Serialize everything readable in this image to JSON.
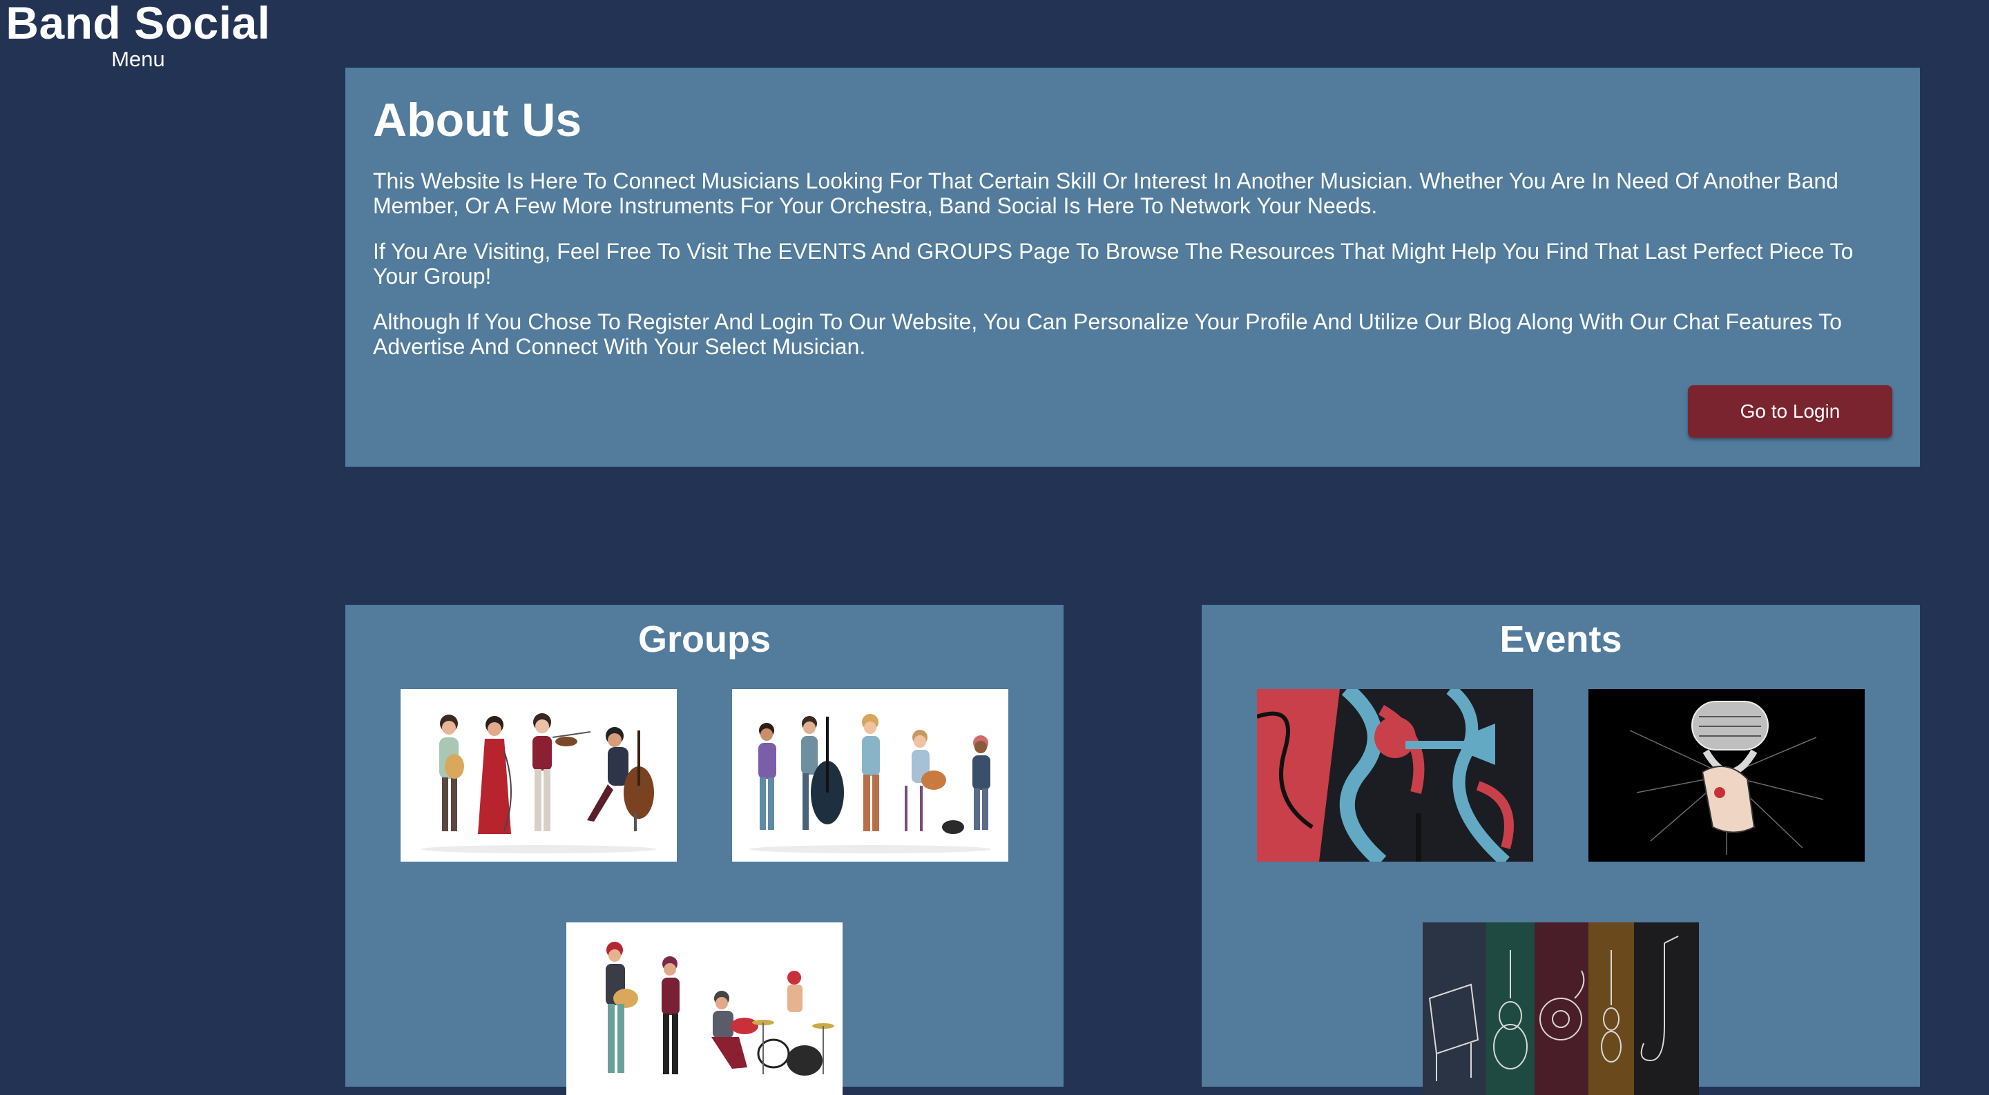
{
  "sidebar": {
    "brand": "Band Social",
    "menu_label": "Menu"
  },
  "about": {
    "title": "About Us",
    "paragraphs": [
      "This Website Is Here To Connect Musicians Looking For That Certain Skill Or Interest In Another Musician. Whether You Are In Need Of Another Band Member, Or A Few More Instruments For Your Orchestra, Band Social Is Here To Network Your Needs.",
      "If You Are Visiting, Feel Free To Visit The EVENTS And GROUPS Page To Browse The Resources That Might Help You Find That Last Perfect Piece To Your Group!",
      "Although If You Chose To Register And Login To Our Website, You Can Personalize Your Profile And Utilize Our Blog Along With Our Chat Features To Advertise And Connect With Your Select Musician."
    ],
    "login_button": "Go to Login"
  },
  "groups": {
    "title": "Groups",
    "images": [
      "quartet-illustration",
      "folk-band-illustration",
      "rock-band-illustration"
    ]
  },
  "events": {
    "title": "Events",
    "images": [
      "jazz-trumpet-poster",
      "vintage-microphone-art",
      "instrument-sketch-banner"
    ]
  },
  "colors": {
    "background": "#223354",
    "panel": "#527b9c",
    "button": "#7a2430",
    "text": "#ffffff"
  }
}
